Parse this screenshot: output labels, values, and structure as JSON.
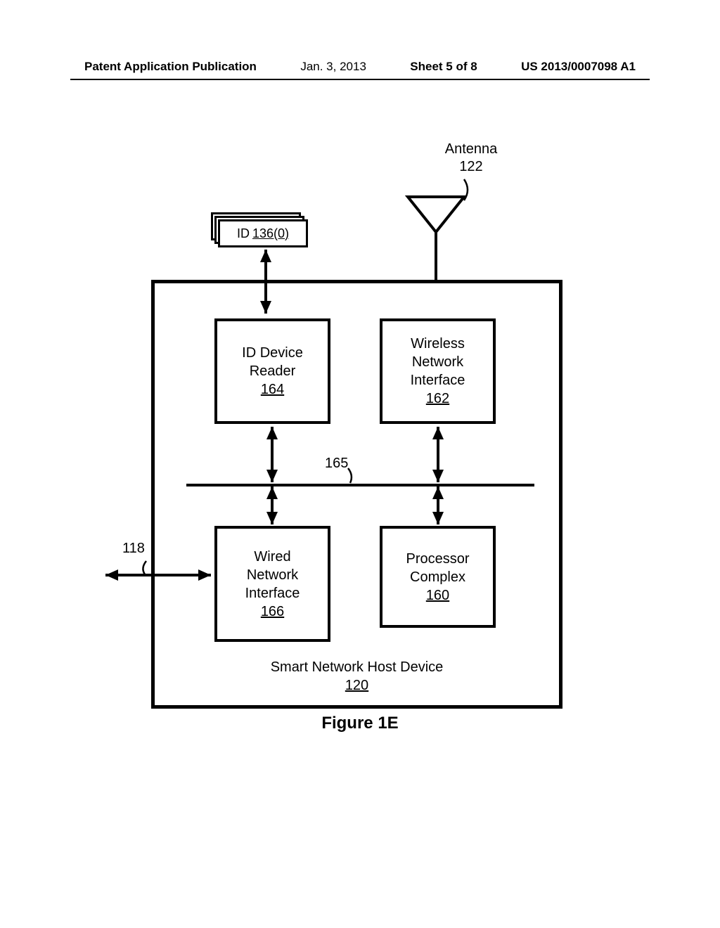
{
  "header": {
    "doc_type": "Patent Application Publication",
    "date": "Jan. 3, 2013",
    "sheet": "Sheet 5 of 8",
    "pub_no": "US 2013/0007098 A1"
  },
  "antenna": {
    "label": "Antenna",
    "ref": "122"
  },
  "id_card": {
    "label": "ID",
    "ref": "136(0)"
  },
  "blocks": {
    "id_reader": {
      "label": "ID Device\nReader",
      "ref": "164"
    },
    "wireless": {
      "label": "Wireless\nNetwork\nInterface",
      "ref": "162"
    },
    "wired": {
      "label": "Wired\nNetwork\nInterface",
      "ref": "166"
    },
    "processor": {
      "label": "Processor\nComplex",
      "ref": "160"
    }
  },
  "bus": {
    "ref": "165"
  },
  "ext_link": {
    "ref": "118"
  },
  "host": {
    "label": "Smart Network Host Device",
    "ref": "120"
  },
  "figure": {
    "label": "Figure 1E"
  }
}
